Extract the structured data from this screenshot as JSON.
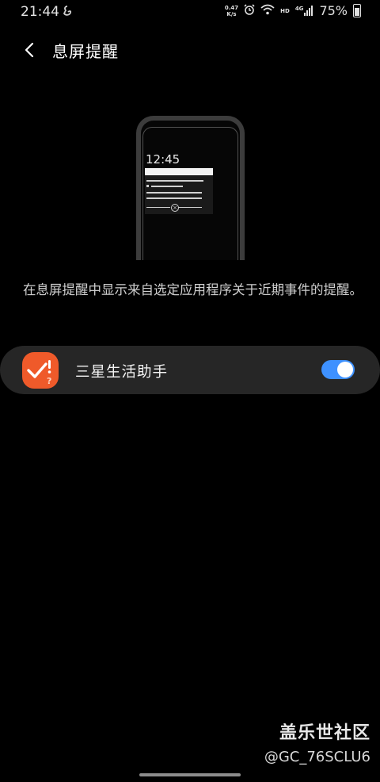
{
  "status_bar": {
    "time": "21:44",
    "net_speed_value": "0.47",
    "net_speed_unit": "K/s",
    "hd_label": "HD",
    "network_label": "4G",
    "battery": "75%"
  },
  "header": {
    "title": "息屏提醒"
  },
  "illustration": {
    "time": "12:45"
  },
  "description": "在息屏提醒中显示来自选定应用程序关于近期事件的提醒。",
  "apps": [
    {
      "name": "三星生活助手",
      "enabled": true
    }
  ],
  "watermark": {
    "title": "盖乐世社区",
    "user": "@GC_76SCLU6"
  },
  "colors": {
    "toggle_on": "#3e91ff",
    "app_icon": "#ef5a2a",
    "row_bg": "#262626"
  }
}
